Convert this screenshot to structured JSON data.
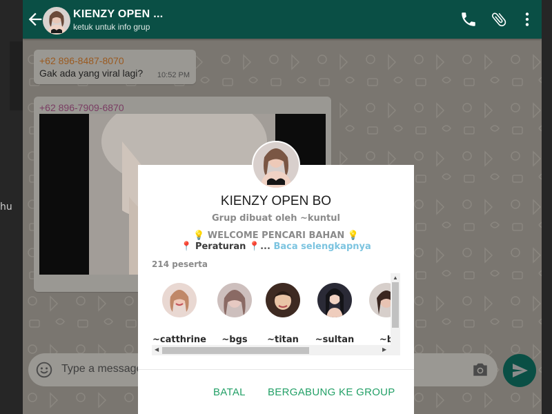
{
  "colors": {
    "header_bg": "#0a4f45",
    "accent_green": "#23a067",
    "link_blue": "#7cc4e0",
    "sender1_color": "#9a5a20",
    "sender2_color": "#7a3d63"
  },
  "left_strip": {
    "stray_text": "hu"
  },
  "header": {
    "title": "KIENZY OPEN ...",
    "subtitle": "ketuk untuk info grup",
    "icons": [
      "back-arrow-icon",
      "group-avatar",
      "phone-icon",
      "paperclip-icon",
      "more-vert-icon"
    ]
  },
  "messages": [
    {
      "sender": "+62 896-8487-8070",
      "text": "Gak ada yang viral lagi?",
      "time": "10:52 PM"
    },
    {
      "sender": "+62 896-7909-6870",
      "type": "image"
    }
  ],
  "composer": {
    "placeholder": "Type a message",
    "icons": [
      "emoji-icon",
      "camera-icon",
      "send-icon"
    ]
  },
  "dialog": {
    "title": "KIENZY OPEN BO",
    "creator": "Grup dibuat oleh ~kuntul",
    "description_line1": "💡 WELCOME PENCARI BAHAN 💡",
    "description_line2_prefix": "📍",
    "description_line2_label": "Peraturan",
    "description_line2_suffix": "📍...",
    "read_more": "Baca selengkapnya",
    "participants": "214 peserta",
    "members": [
      {
        "name": "~catthrine"
      },
      {
        "name": "~bgs"
      },
      {
        "name": "~titan"
      },
      {
        "name": "~sultan"
      },
      {
        "name": "~b"
      }
    ],
    "cancel_label": "BATAL",
    "join_label": "BERGABUNG KE GROUP"
  }
}
